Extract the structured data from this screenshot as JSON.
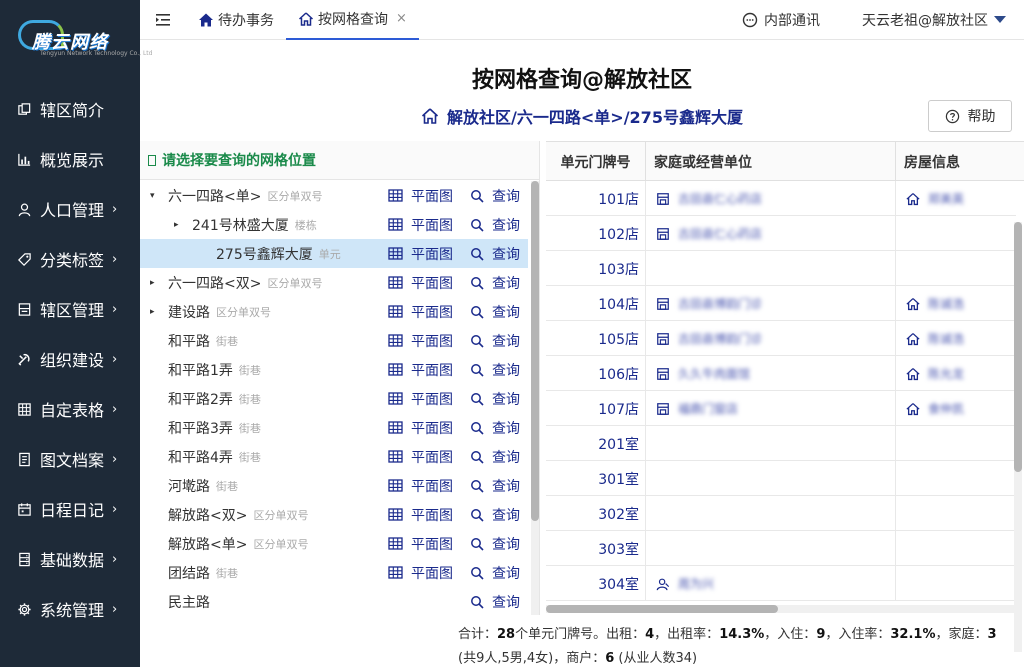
{
  "brand": {
    "name": "腾云网络",
    "subtitle": "Tengyun Network Technology Co., Ltd"
  },
  "sidebar": {
    "items": [
      {
        "label": "辖区简介",
        "icon": "copy-icon",
        "arrow": false
      },
      {
        "label": "概览展示",
        "icon": "bar-chart-icon",
        "arrow": false
      },
      {
        "label": "人口管理",
        "icon": "user-icon",
        "arrow": true
      },
      {
        "label": "分类标签",
        "icon": "tag-icon",
        "arrow": true
      },
      {
        "label": "辖区管理",
        "icon": "building-icon",
        "arrow": true
      },
      {
        "label": "组织建设",
        "icon": "party-icon",
        "arrow": true
      },
      {
        "label": "自定表格",
        "icon": "table-icon",
        "arrow": true
      },
      {
        "label": "图文档案",
        "icon": "document-icon",
        "arrow": true
      },
      {
        "label": "日程日记",
        "icon": "calendar-icon",
        "arrow": true
      },
      {
        "label": "基础数据",
        "icon": "database-icon",
        "arrow": true
      },
      {
        "label": "系统管理",
        "icon": "gear-icon",
        "arrow": true
      }
    ],
    "arrow_glyph": "›"
  },
  "topbar": {
    "tabs": [
      {
        "label": "待办事务",
        "active": false
      },
      {
        "label": "按网格查询",
        "active": true,
        "close": "×"
      }
    ],
    "messages_label": "内部通讯",
    "user_label": "天云老祖@解放社区"
  },
  "page": {
    "title": "按网格查询@解放社区",
    "breadcrumb": "解放社区/六一四路<单>/275号鑫辉大厦",
    "help_label": "帮助"
  },
  "tree": {
    "header": "请选择要查询的网格位置",
    "plan_label": "平面图",
    "query_label": "查询",
    "nodes": [
      {
        "name": "六一四路<单>",
        "type": "区分单双号",
        "indent": 0,
        "arrow": "▾",
        "plan": true,
        "selected": false
      },
      {
        "name": "241号林盛大厦",
        "type": "楼栋",
        "indent": 1,
        "arrow": "▸",
        "plan": true,
        "selected": false
      },
      {
        "name": "275号鑫辉大厦",
        "type": "单元",
        "indent": 2,
        "arrow": "",
        "plan": true,
        "selected": true
      },
      {
        "name": "六一四路<双>",
        "type": "区分单双号",
        "indent": 0,
        "arrow": "▸",
        "plan": true,
        "selected": false
      },
      {
        "name": "建设路",
        "type": "区分单双号",
        "indent": 0,
        "arrow": "▸",
        "plan": true,
        "selected": false
      },
      {
        "name": "和平路",
        "type": "街巷",
        "indent": 0,
        "arrow": "",
        "plan": true,
        "selected": false
      },
      {
        "name": "和平路1弄",
        "type": "街巷",
        "indent": 0,
        "arrow": "",
        "plan": true,
        "selected": false
      },
      {
        "name": "和平路2弄",
        "type": "街巷",
        "indent": 0,
        "arrow": "",
        "plan": true,
        "selected": false
      },
      {
        "name": "和平路3弄",
        "type": "街巷",
        "indent": 0,
        "arrow": "",
        "plan": true,
        "selected": false
      },
      {
        "name": "和平路4弄",
        "type": "街巷",
        "indent": 0,
        "arrow": "",
        "plan": true,
        "selected": false
      },
      {
        "name": "河墘路",
        "type": "街巷",
        "indent": 0,
        "arrow": "",
        "plan": true,
        "selected": false
      },
      {
        "name": "解放路<双>",
        "type": "区分单双号",
        "indent": 0,
        "arrow": "",
        "plan": true,
        "selected": false
      },
      {
        "name": "解放路<单>",
        "type": "区分单双号",
        "indent": 0,
        "arrow": "",
        "plan": true,
        "selected": false
      },
      {
        "name": "团结路",
        "type": "街巷",
        "indent": 0,
        "arrow": "",
        "plan": true,
        "selected": false
      },
      {
        "name": "民主路",
        "type": "",
        "indent": 0,
        "arrow": "",
        "plan": false,
        "selected": false
      }
    ]
  },
  "table": {
    "headers": [
      "单元门牌号",
      "家庭或经营单位",
      "房屋信息"
    ],
    "rows": [
      {
        "unit": "101店",
        "family": "古田县仁心药店",
        "family_icon": "shop-icon",
        "house": "郑美英",
        "house_icon": "home-icon"
      },
      {
        "unit": "102店",
        "family": "古田县仁心药店",
        "family_icon": "shop-icon",
        "house": "",
        "house_icon": ""
      },
      {
        "unit": "103店",
        "family": "",
        "family_icon": "",
        "house": "",
        "house_icon": ""
      },
      {
        "unit": "104店",
        "family": "古田县博韵门诊",
        "family_icon": "shop-icon",
        "house": "陈诚浩",
        "house_icon": "home-icon"
      },
      {
        "unit": "105店",
        "family": "古田县博韵门诊",
        "family_icon": "shop-icon",
        "house": "陈诚浩",
        "house_icon": "home-icon"
      },
      {
        "unit": "106店",
        "family": "久久牛肉面馆",
        "family_icon": "shop-icon",
        "house": "陈允龙",
        "house_icon": "home-icon"
      },
      {
        "unit": "107店",
        "family": "福鼎门窗店",
        "family_icon": "shop-icon",
        "house": "食仲凯",
        "house_icon": "home-icon"
      },
      {
        "unit": "201室",
        "family": "",
        "family_icon": "",
        "house": "",
        "house_icon": ""
      },
      {
        "unit": "301室",
        "family": "",
        "family_icon": "",
        "house": "",
        "house_icon": ""
      },
      {
        "unit": "302室",
        "family": "",
        "family_icon": "",
        "house": "",
        "house_icon": ""
      },
      {
        "unit": "303室",
        "family": "",
        "family_icon": "",
        "house": "",
        "house_icon": ""
      },
      {
        "unit": "304室",
        "family": "周为兴",
        "family_icon": "person-icon",
        "house": "",
        "house_icon": ""
      }
    ]
  },
  "summary": {
    "total_label": "合计：",
    "units": "28",
    "units_suffix": "个单元门牌号。出租：",
    "rent": "4",
    "rent_rate_label": "，出租率：",
    "rent_rate": "14.3%",
    "occupied_label": "，入住：",
    "occupied": "9",
    "occupancy_label": "，入住率：",
    "occupancy": "32.1%",
    "family_label": "，家庭：",
    "families": "3",
    "family_detail": " (共9人,5男,4女)，商户：",
    "merchants": "6",
    "merchant_detail": " (从业人数34)"
  },
  "colors": {
    "sidebar_bg": "#1e2a38",
    "accent": "#2d5bd6",
    "link": "#1a2a8c",
    "tree_header": "#1a8a4a",
    "selected_row": "#cfe6f8"
  }
}
